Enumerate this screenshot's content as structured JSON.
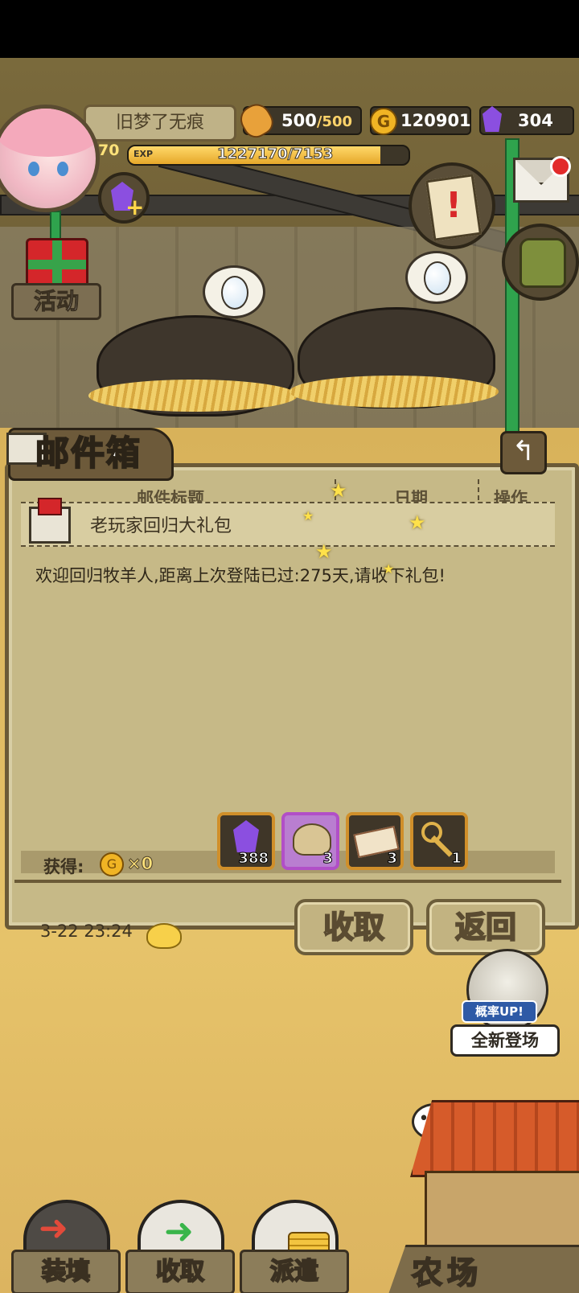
{
  "hud": {
    "player_name": "旧梦了无痕",
    "level": "70",
    "exp_label": "EXP",
    "exp_value": "1227170/7153",
    "exp_fraction": 0.9,
    "bread_current": "500",
    "bread_max": "/500",
    "gold": "120901",
    "gems": "304",
    "gold_icon_letter": "G"
  },
  "side": {
    "activity_label": "活动"
  },
  "mailbox": {
    "title": "邮件箱",
    "col_subject": "邮件标题",
    "col_date": "日期",
    "col_action": "操作",
    "mail_subject": "老玩家回归大礼包",
    "mail_body": "欢迎回归牧羊人,距离上次登陆已过:275天,请收下礼包!",
    "obtain_label": "获得:",
    "obtain_gold": "×0",
    "items": [
      {
        "name": "purple-gem",
        "count": "388",
        "border": "#d08f2a"
      },
      {
        "name": "food-basket",
        "count": "3",
        "border": "#b14fc7"
      },
      {
        "name": "ticket",
        "count": "3",
        "border": "#d08f2a"
      },
      {
        "name": "key",
        "count": "1",
        "border": "#d08f2a"
      }
    ],
    "timestamp": "3-22 23:24",
    "collect_label": "收取",
    "return_label": "返回"
  },
  "promo": {
    "rate_up": "概率UP!",
    "new_arrival": "全新登场"
  },
  "bottom": {
    "load_label": "装填",
    "collect_label": "收取",
    "dispatch_label": "派遣",
    "farm_label": "农场"
  },
  "colors": {
    "panel_bg": "#c6b987",
    "panel_border": "#6b5a37",
    "exp_bar": "#f0c24a",
    "gem_purple": "#8b4fe0",
    "gold_coin": "#f0b424",
    "notification_red": "#e22a2a"
  }
}
